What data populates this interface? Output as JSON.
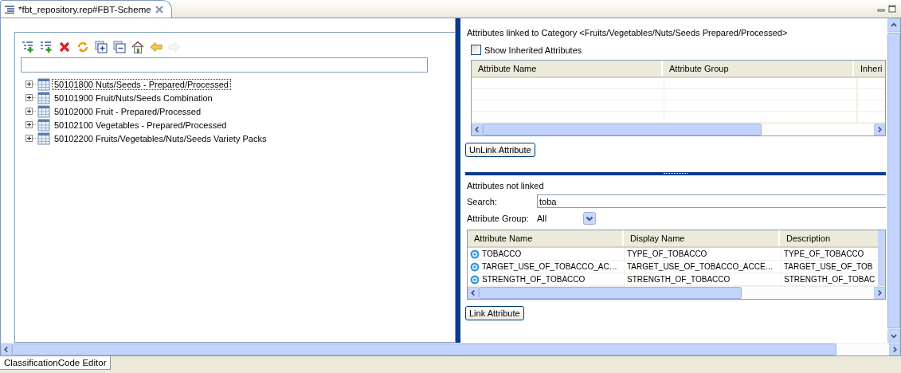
{
  "editor_tab": {
    "title": "*fbt_repository.rep#FBT-Scheme"
  },
  "toolbar": [
    {
      "kind": "add-child",
      "disabled": false
    },
    {
      "kind": "add-sibling",
      "disabled": false
    },
    {
      "kind": "delete",
      "disabled": false
    },
    {
      "kind": "refresh",
      "disabled": false
    },
    {
      "kind": "expand",
      "disabled": false
    },
    {
      "kind": "collapse",
      "disabled": false
    },
    {
      "kind": "home",
      "disabled": false
    },
    {
      "kind": "back",
      "disabled": false
    },
    {
      "kind": "forward",
      "disabled": true
    }
  ],
  "tree": [
    {
      "label": "50101800 Nuts/Seeds - Prepared/Processed",
      "selected": true,
      "expanded": false
    },
    {
      "label": "50101900 Fruit/Nuts/Seeds Combination",
      "selected": false,
      "expanded": false
    },
    {
      "label": "50102000 Fruit - Prepared/Processed",
      "selected": false,
      "expanded": false
    },
    {
      "label": "50102100 Vegetables - Prepared/Processed",
      "selected": false,
      "expanded": false
    },
    {
      "label": "50102200 Fruits/Vegetables/Nuts/Seeds Variety Packs",
      "selected": false,
      "expanded": false
    }
  ],
  "linked": {
    "title": "Attributes linked to Category <Fruits/Vegetables/Nuts/Seeds Prepared/Processed>",
    "show_inherited": {
      "label": "Show Inherited Attributes",
      "checked": false
    },
    "table": {
      "columns": [
        "Attribute Name",
        "Attribute Group",
        "Inheri"
      ]
    },
    "button": "UnLink Attribute"
  },
  "not_linked": {
    "title": "Attributes not linked",
    "search": {
      "label": "Search:",
      "value": "toba"
    },
    "group": {
      "label": "Attribute Group:",
      "value": "All"
    },
    "table": {
      "columns": [
        "Attribute Name",
        "Display Name",
        "Description"
      ],
      "rows": [
        [
          "TOBACCO",
          "TYPE_OF_TOBACCO",
          "TYPE_OF_TOBACCO"
        ],
        [
          "TARGET_USE_OF_TOBACCO_AC…",
          "TARGET_USE_OF_TOBACCO_ACCE…",
          "TARGET_USE_OF_TOB"
        ],
        [
          "STRENGTH_OF_TOBACCO",
          "STRENGTH_OF_TOBACCO",
          "STRENGTH_OF_TOBAC"
        ]
      ]
    },
    "button": "Link Attribute"
  },
  "bottom_tab": {
    "title": "ClassificationCode Editor"
  }
}
